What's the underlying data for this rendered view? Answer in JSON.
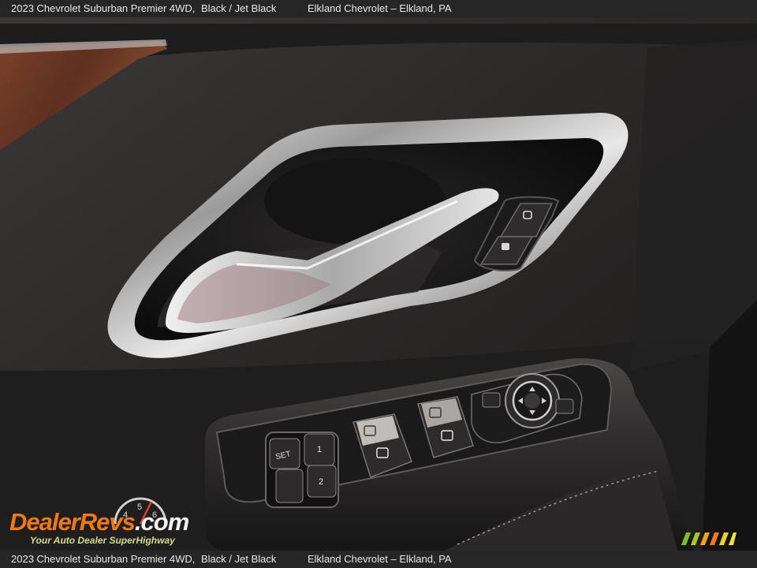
{
  "caption": {
    "title": "2023 Chevrolet Suburban Premier 4WD,",
    "trim": "Black / Jet Black",
    "dealer": "Elkland Chevrolet – Elkland, PA"
  },
  "switches": {
    "memory_set": "SET",
    "memory_1": "1",
    "memory_2": "2"
  },
  "watermark": {
    "brand_prefix": "Dealer",
    "brand_suffix": "Revs",
    "domain": ".com",
    "tagline": "Your Auto Dealer SuperHighway",
    "gauge_digits": [
      "4",
      "5",
      "6"
    ]
  },
  "colors": {
    "accent": "#f07a10",
    "door_panel": "#242222",
    "wood_trim": "#6e3a24",
    "chrome": "#d8d8d8"
  }
}
